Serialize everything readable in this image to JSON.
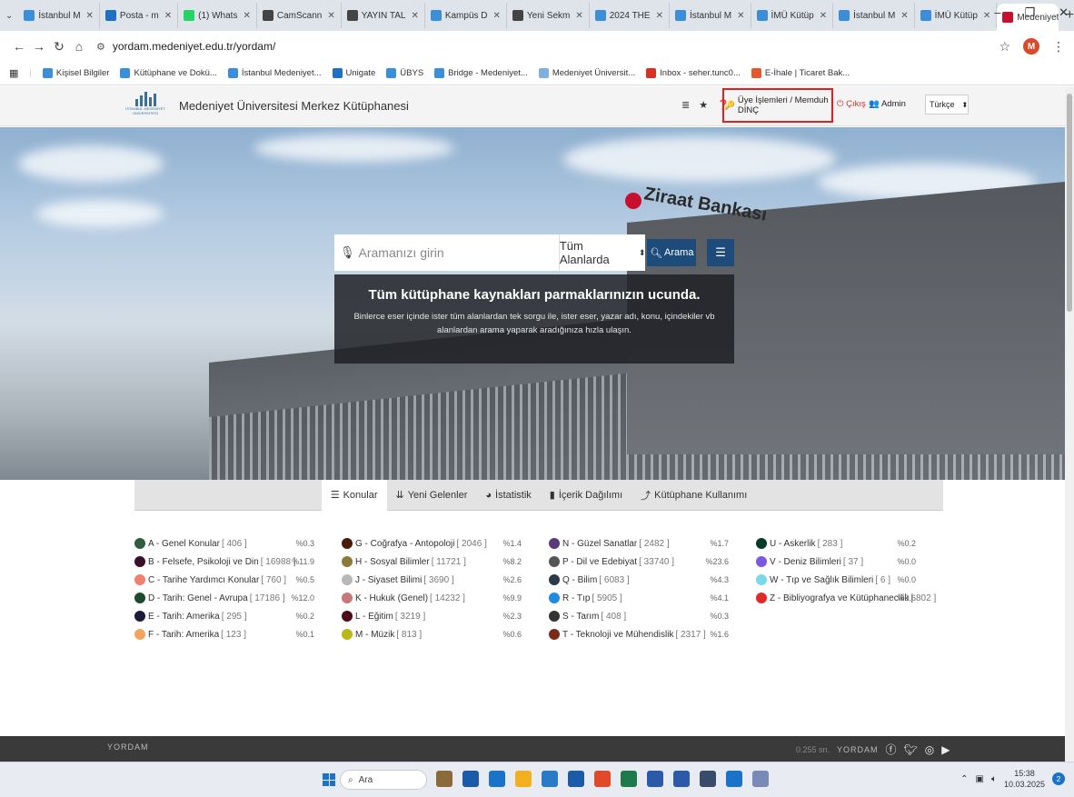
{
  "browser": {
    "tabs": [
      {
        "label": "İstanbul M",
        "color": "#3a8fd8"
      },
      {
        "label": "Posta - m",
        "color": "#1f6fc5"
      },
      {
        "label": "(1) Whats",
        "color": "#25d366"
      },
      {
        "label": "CamScann",
        "color": "#444444"
      },
      {
        "label": "YAYIN TAL",
        "color": "#444444"
      },
      {
        "label": "Kampüs D",
        "color": "#3a8fd8"
      },
      {
        "label": "Yeni Sekm",
        "color": "#444444"
      },
      {
        "label": "2024 THE",
        "color": "#3a8fd8"
      },
      {
        "label": "İstanbul M",
        "color": "#3a8fd8"
      },
      {
        "label": "İMÜ Kütüp",
        "color": "#3a8fd8"
      },
      {
        "label": "İstanbul M",
        "color": "#3a8fd8"
      },
      {
        "label": "İMÜ Kütüp",
        "color": "#3a8fd8"
      }
    ],
    "active_tab": {
      "label": "Medeniyet",
      "color": "#c8102e"
    },
    "new_tab": "+",
    "url": "yordam.medeniyet.edu.tr/yordam/",
    "profile_letter": "M",
    "bookmarks": [
      {
        "label": "Kişisel Bilgiler",
        "color": "#3a8fd8"
      },
      {
        "label": "Kütüphane ve Dokü...",
        "color": "#3a8fd8"
      },
      {
        "label": "İstanbul Medeniyet...",
        "color": "#3a8fd8"
      },
      {
        "label": "Unigate",
        "color": "#1f6fc5"
      },
      {
        "label": "ÜBYS",
        "color": "#3a8fd8"
      },
      {
        "label": "Bridge - Medeniyet...",
        "color": "#3a8fd8"
      },
      {
        "label": "Medeniyet Üniversit...",
        "color": "#7fb0e0"
      },
      {
        "label": "Inbox - seher.tunc0...",
        "color": "#d93025"
      },
      {
        "label": "E-İhale | Ticaret Bak...",
        "color": "#e05a2b"
      }
    ]
  },
  "site": {
    "logo_text": "İSTANBUL MEDENİYET ÜNİVERSİTESİ",
    "title": "Medeniyet Üniversitesi Merkez Kütüphanesi",
    "member_link": "Üye İşlemleri / Memduh DİNÇ",
    "logout": "Çıkış",
    "admin": "Admin",
    "language": "Türkçe"
  },
  "hero": {
    "search_placeholder": "Aramanızı girin",
    "scope": "Tüm Alanlarda",
    "search_button": "Arama",
    "headline": "Tüm kütüphane kaynakları parmaklarınızın ucunda.",
    "subtext": "Binlerce eser içinde ister tüm alanlardan tek sorgu ile, ister eser, yazar adı, konu, içindekiler vb alanlardan arama yaparak aradığınıza hızla ulaşın.",
    "bank_name": "Ziraat Bankası"
  },
  "tabs": [
    {
      "label": "Konular",
      "icon": "☰"
    },
    {
      "label": "Yeni Gelenler",
      "icon": "⇊"
    },
    {
      "label": "İstatistik",
      "icon": "◕"
    },
    {
      "label": "İçerik Dağılımı",
      "icon": "▮"
    },
    {
      "label": "Kütüphane Kullanımı",
      "icon": "⤴"
    }
  ],
  "topics": [
    [
      {
        "label": "A - Genel Konular",
        "count": "[ 406 ]",
        "pct": "%0.3",
        "color": "#2e5e3e"
      },
      {
        "label": "B - Felsefe, Psikoloji ve Din",
        "count": "[ 16988 ]",
        "pct": "%11.9",
        "color": "#3a0f2a"
      },
      {
        "label": "C - Tarihe Yardımcı Konular",
        "count": "[ 760 ]",
        "pct": "%0.5",
        "color": "#f08070"
      },
      {
        "label": "D - Tarih: Genel - Avrupa",
        "count": "[ 17186 ]",
        "pct": "%12.0",
        "color": "#1f4a2e"
      },
      {
        "label": "E - Tarih: Amerika",
        "count": "[ 295 ]",
        "pct": "%0.2",
        "color": "#1a1a3a"
      },
      {
        "label": "F - Tarih: Amerika",
        "count": "[ 123 ]",
        "pct": "%0.1",
        "color": "#f4a460"
      }
    ],
    [
      {
        "label": "G - Coğrafya - Antopoloji",
        "count": "[ 2046 ]",
        "pct": "%1.4",
        "color": "#4a1a0a"
      },
      {
        "label": "H - Sosyal Bilimler",
        "count": "[ 11721 ]",
        "pct": "%8.2",
        "color": "#8a7a3a"
      },
      {
        "label": "J - Siyaset Bilimi",
        "count": "[ 3690 ]",
        "pct": "%2.6",
        "color": "#b8b8b8"
      },
      {
        "label": "K - Hukuk (Genel)",
        "count": "[ 14232 ]",
        "pct": "%9.9",
        "color": "#c87878"
      },
      {
        "label": "L - Eğitim",
        "count": "[ 3219 ]",
        "pct": "%2.3",
        "color": "#4a0a1a"
      },
      {
        "label": "M - Müzik",
        "count": "[ 813 ]",
        "pct": "%0.6",
        "color": "#b8b81a"
      }
    ],
    [
      {
        "label": "N - Güzel Sanatlar",
        "count": "[ 2482 ]",
        "pct": "%1.7",
        "color": "#5a3a7a"
      },
      {
        "label": "P - Dil ve Edebiyat",
        "count": "[ 33740 ]",
        "pct": "%23.6",
        "color": "#555555"
      },
      {
        "label": "Q - Bilim",
        "count": "[ 6083 ]",
        "pct": "%4.3",
        "color": "#2a3a4a"
      },
      {
        "label": "R - Tıp",
        "count": "[ 5905 ]",
        "pct": "%4.1",
        "color": "#1e8ae0"
      },
      {
        "label": "S - Tarım",
        "count": "[ 408 ]",
        "pct": "%0.3",
        "color": "#333333"
      },
      {
        "label": "T - Teknoloji ve Mühendislik",
        "count": "[ 2317 ]",
        "pct": "%1.6",
        "color": "#7a2a1a"
      }
    ],
    [
      {
        "label": "U - Askerlik",
        "count": "[ 283 ]",
        "pct": "%0.2",
        "color": "#0a3a2a"
      },
      {
        "label": "V - Deniz Bilimleri",
        "count": "[ 37 ]",
        "pct": "%0.0",
        "color": "#7a5ae0"
      },
      {
        "label": "W - Tıp ve Sağlık Bilimleri",
        "count": "[ 6 ]",
        "pct": "%0.0",
        "color": "#7ad8e8"
      },
      {
        "label": "Z - Bibliyografya ve Kütüphanecilik",
        "count": "[ 802 ]",
        "pct": "%0.6",
        "color": "#e02a2a"
      }
    ]
  ],
  "footer": {
    "logo": "YORDAM",
    "timing": "0.255 sn.",
    "right_logo": "YORDAM"
  },
  "taskbar": {
    "search": "Ara",
    "time": "15:38",
    "date": "10.03.2025",
    "notifications": "2",
    "app_colors": [
      "#8a6a3a",
      "#1a5aa8",
      "#1a73c8",
      "#f2b01e",
      "#2a7ac8",
      "#1a5aa8",
      "#e04a2a",
      "#1e7a4a",
      "#2a5aa8",
      "#2a5aa8",
      "#3a4a6a",
      "#1a73c8",
      "#7a8ab8"
    ]
  }
}
